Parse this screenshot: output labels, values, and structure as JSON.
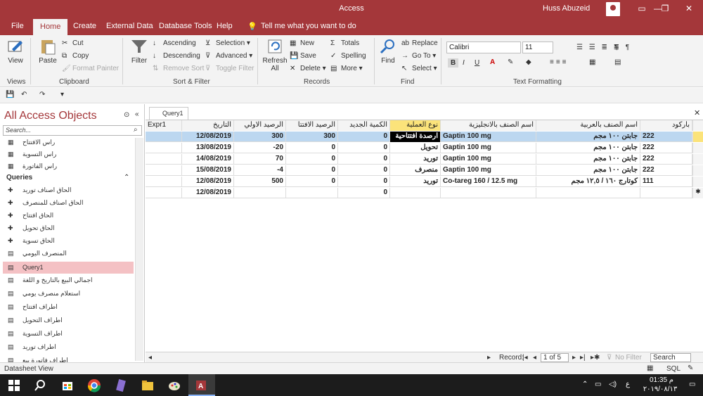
{
  "window": {
    "title": "Access",
    "user": "Huss Abuzeid",
    "minimize": "—",
    "restore": "❐",
    "close": "✕"
  },
  "tabs": [
    {
      "label": "File"
    },
    {
      "label": "Home"
    },
    {
      "label": "Create"
    },
    {
      "label": "External Data"
    },
    {
      "label": "Database Tools"
    },
    {
      "label": "Help"
    },
    {
      "label": "Tell me what you want to do"
    }
  ],
  "ribbon": {
    "views": {
      "view": "View",
      "group": "Views"
    },
    "clipboard": {
      "paste": "Paste",
      "cut": "Cut",
      "copy": "Copy",
      "format_painter": "Format Painter",
      "group": "Clipboard"
    },
    "sort_filter": {
      "filter": "Filter",
      "ascending": "Ascending",
      "descending": "Descending",
      "remove_sort": "Remove Sort",
      "selection": "Selection",
      "advanced": "Advanced",
      "toggle_filter": "Toggle Filter",
      "group": "Sort & Filter"
    },
    "records": {
      "refresh": "Refresh",
      "refresh2": "All",
      "new": "New",
      "save": "Save",
      "delete": "Delete",
      "totals": "Totals",
      "spelling": "Spelling",
      "more": "More",
      "group": "Records"
    },
    "find": {
      "find": "Find",
      "replace": "Replace",
      "goto": "Go To",
      "select": "Select",
      "group": "Find"
    },
    "text_formatting": {
      "font": "Calibri",
      "size": "11",
      "bold": "B",
      "italic": "I",
      "underline": "U",
      "group": "Text Formatting"
    }
  },
  "nav": {
    "header": "All Access Objects",
    "search_placeholder": "Search...",
    "tables": [
      "راس الافتتاح",
      "راس التسوية",
      "راس الفاتورة"
    ],
    "queries_header": "Queries",
    "queries": [
      "الحاق اصناف توريد",
      "الحاق اصناف للمنصرف",
      "الحاق افتتاح",
      "الحاق تحويل",
      "الحاق تسوية",
      "المنصرف اليومي",
      "Query1",
      "اجمالي البيع بالتاريخ و اللغة",
      "استعلام منصرف يومي",
      "اطراف افتتاح",
      "اطراف التحويل",
      "اطراف التسوية",
      "اطراف توريد",
      "اطراف فاتورة بيع"
    ]
  },
  "doc": {
    "tab": "Query1",
    "columns": [
      "Expr1",
      "التاريخ",
      "الرصيد الاولي",
      "الرصيد الافتتا",
      "الكمية الجديد",
      "نوع العملية",
      "اسم الصنف بالانجليزية",
      "اسم الصنف بالعربية",
      "باركود"
    ],
    "rows": [
      [
        "",
        "12/08/2019",
        "300",
        "300",
        "0",
        "ارصدة افتتاحية",
        "Gaptin 100 mg",
        "جابتن ١٠٠ مجم",
        "222"
      ],
      [
        "",
        "13/08/2019",
        "-20",
        "0",
        "0",
        "تحويل",
        "Gaptin 100 mg",
        "جابتن ١٠٠ مجم",
        "222"
      ],
      [
        "",
        "14/08/2019",
        "70",
        "0",
        "0",
        "توريد",
        "Gaptin 100 mg",
        "جابتن ١٠٠ مجم",
        "222"
      ],
      [
        "",
        "15/08/2019",
        "-4",
        "0",
        "0",
        "منصرف",
        "Gaptin 100 mg",
        "جابتن ١٠٠ مجم",
        "222"
      ],
      [
        "",
        "12/08/2019",
        "500",
        "0",
        "0",
        "توريد",
        "Co-tareg 160 / 12.5 mg",
        "كوتارج ١٦٠ / ١٢,٥ مجم",
        "111"
      ],
      [
        "",
        "12/08/2019",
        "",
        "",
        "0",
        "",
        "",
        "",
        ""
      ]
    ],
    "record_label": "Record:",
    "record_value": "1 of 5",
    "no_filter": "No Filter",
    "search": "Search"
  },
  "status": {
    "text": "Datasheet View",
    "sql": "SQL"
  },
  "taskbar": {
    "time": "01:35 م",
    "date": "٢٠١٩/٠٨/١٣",
    "lang": "ع"
  },
  "colors": {
    "accent": "#a4373a",
    "selected_row": "#bcd7f0",
    "selected_nav": "#f4c1c4",
    "active_header": "#fbe37a"
  }
}
